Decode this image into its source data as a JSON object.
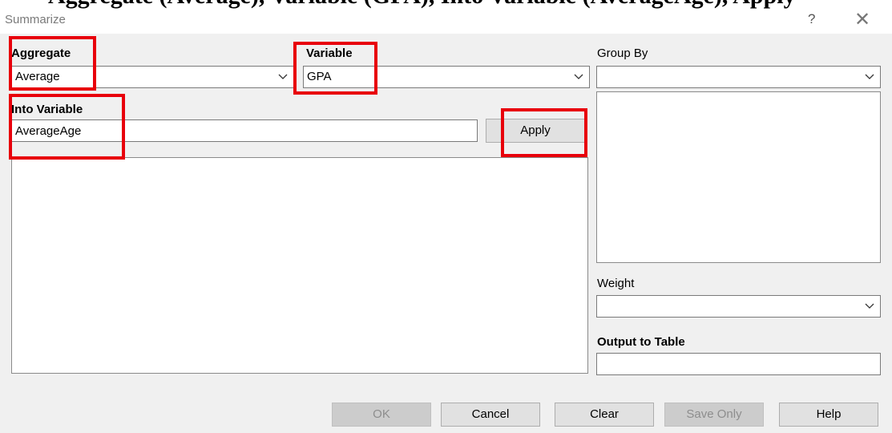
{
  "caption_text": "Aggregate (Average), Variable (GPA), Into Variable (AverageAge), Apply",
  "window": {
    "title": "Summarize",
    "help_glyph": "?",
    "close_glyph": "✕"
  },
  "aggregate": {
    "label": "Aggregate",
    "value": "Average"
  },
  "variable": {
    "label": "Variable",
    "value": "GPA"
  },
  "into_variable": {
    "label": "Into Variable",
    "value": "AverageAge"
  },
  "apply_button": "Apply",
  "group_by": {
    "label": "Group By",
    "value": ""
  },
  "weight": {
    "label": "Weight",
    "value": ""
  },
  "output_to_table": {
    "label": "Output to Table",
    "value": ""
  },
  "buttons": {
    "ok": "OK",
    "cancel": "Cancel",
    "clear": "Clear",
    "save_only": "Save Only",
    "help": "Help"
  },
  "colors": {
    "highlight": "#e8000b",
    "disabled_button": "#cccccc",
    "background": "#f0f0f0"
  },
  "icons": {
    "dropdown": "chevron-down-icon",
    "help": "question-mark-icon",
    "close": "close-icon"
  }
}
